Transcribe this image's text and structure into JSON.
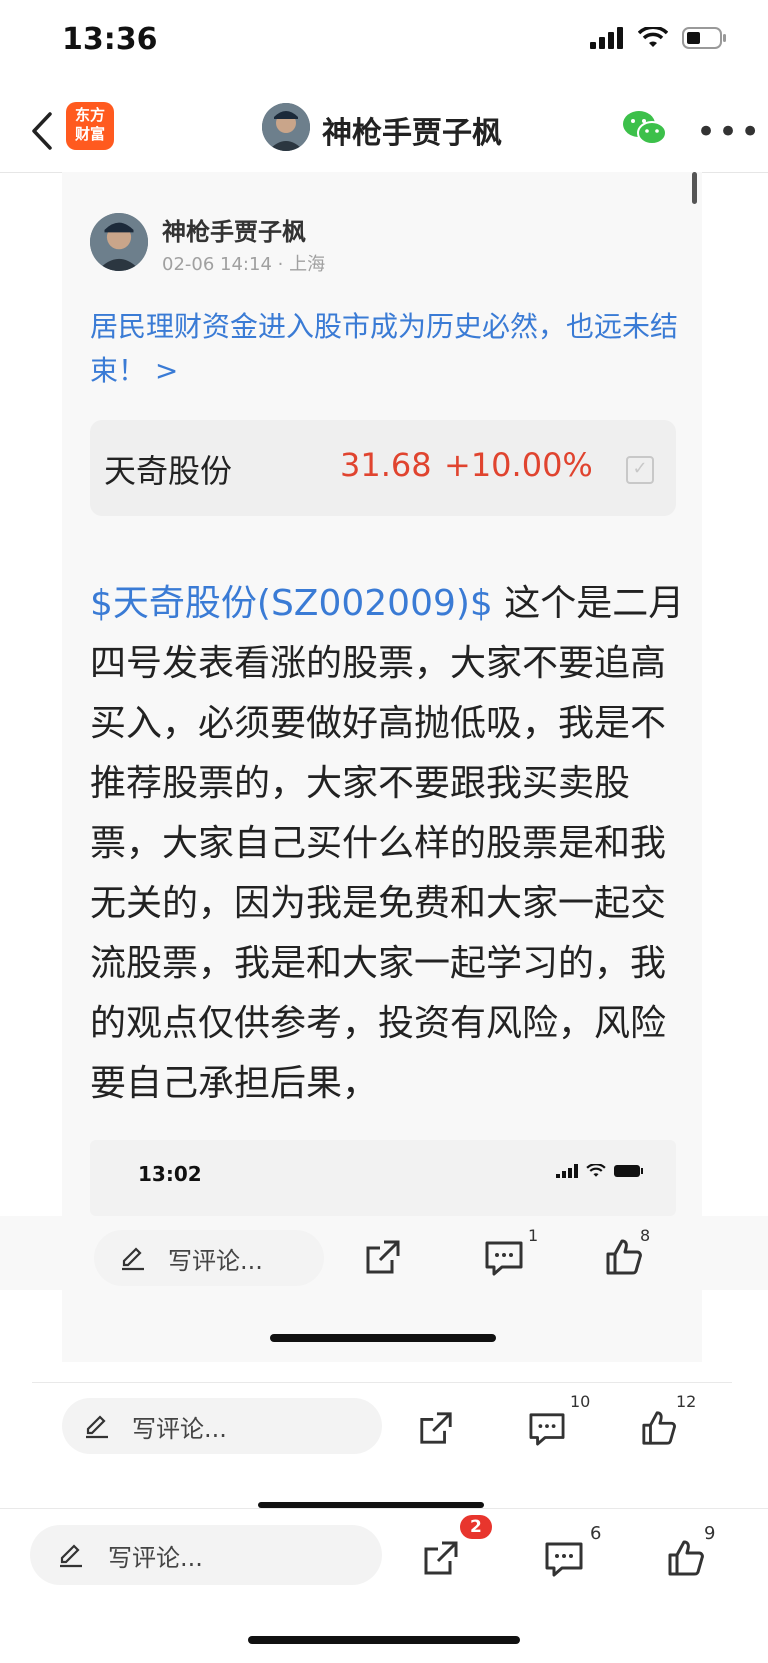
{
  "status": {
    "time": "13:36"
  },
  "nav": {
    "logo_line1": "东方",
    "logo_line2": "财富",
    "title": "神枪手贾子枫"
  },
  "post": {
    "author": "神枪手贾子枫",
    "meta": "02-06 14:14 · 上海",
    "headline": "居民理财资金进入股市成为历史必然，也远未结束！ >",
    "stock": {
      "name": "天奇股份",
      "price": "31.68",
      "change": "+10.00%"
    },
    "link": "$天奇股份(SZ002009)$",
    "body": " 这个是二月四号发表看涨的股票，大家不要追高买入，必须要做好高抛低吸，我是不推荐股票的，大家不要跟我买卖股票，大家自己买什么样的股票是和我无关的，因为我是免费和大家一起交流股票，我是和大家一起学习的，我的观点仅供参考，投资有风险，风险要自己承担后果，"
  },
  "embed": {
    "time": "13:02"
  },
  "action_rows": [
    {
      "comment_placeholder": "写评论...",
      "comments": "1",
      "likes": "8"
    },
    {
      "comment_placeholder": "写评论...",
      "comments": "10",
      "likes": "12"
    },
    {
      "comment_placeholder": "写评论...",
      "share_badge": "2",
      "comments": "6",
      "likes": "9"
    }
  ]
}
